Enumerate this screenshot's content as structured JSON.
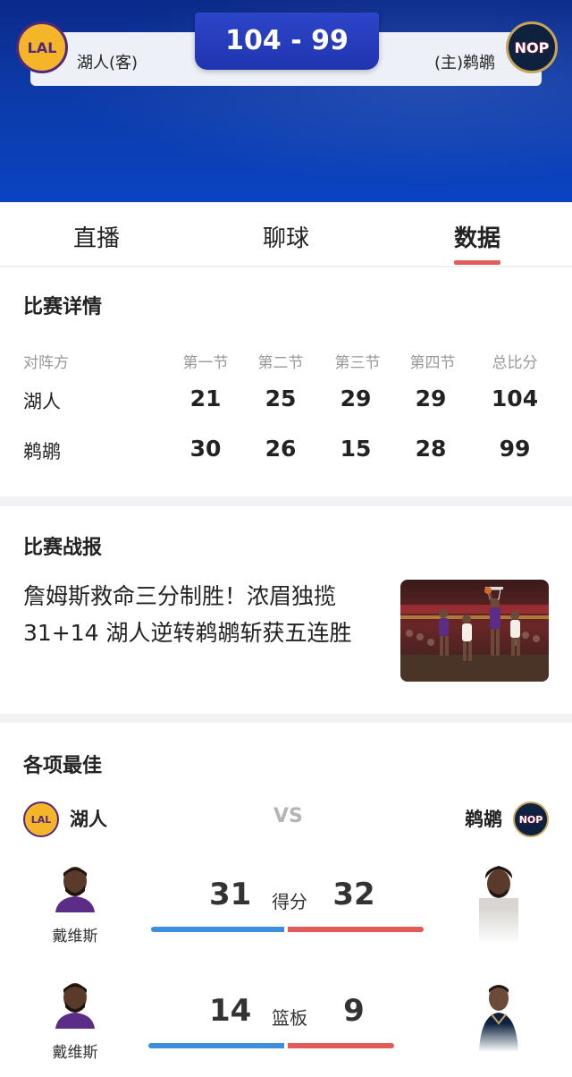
{
  "header": {
    "score": "104 - 99",
    "away_team": "湖人(客)",
    "home_team": "(主)鹈鹕",
    "away_logo": "LAL",
    "home_logo": "NOP"
  },
  "tabs": [
    {
      "label": "直播",
      "active": false
    },
    {
      "label": "聊球",
      "active": false
    },
    {
      "label": "数据",
      "active": true
    }
  ],
  "details": {
    "title": "比赛详情",
    "headers": [
      "对阵方",
      "第一节",
      "第二节",
      "第三节",
      "第四节",
      "总比分"
    ],
    "rows": [
      {
        "team": "湖人",
        "q": [
          "21",
          "25",
          "29",
          "29"
        ],
        "total": "104"
      },
      {
        "team": "鹈鹕",
        "q": [
          "30",
          "26",
          "15",
          "28"
        ],
        "total": "99"
      }
    ]
  },
  "report": {
    "title": "比赛战报",
    "headline": "詹姆斯救命三分制胜！浓眉独揽31+14 湖人逆转鹈鹕斩获五连胜"
  },
  "leaders": {
    "title": "各项最佳",
    "left_team": "湖人",
    "right_team": "鹈鹕",
    "vs": "VS",
    "stats": [
      {
        "label": "得分",
        "left_value": "31",
        "right_value": "32",
        "left_player": "戴维斯",
        "left_share": 0.49,
        "right_share": 0.51
      },
      {
        "label": "篮板",
        "left_value": "14",
        "right_value": "9",
        "left_player": "戴维斯",
        "left_share": 0.61,
        "right_share": 0.39
      }
    ]
  },
  "colors": {
    "accent_red": "#e25a5a",
    "accent_blue": "#3e8ee0",
    "header_blue": "#0d3aa8"
  }
}
